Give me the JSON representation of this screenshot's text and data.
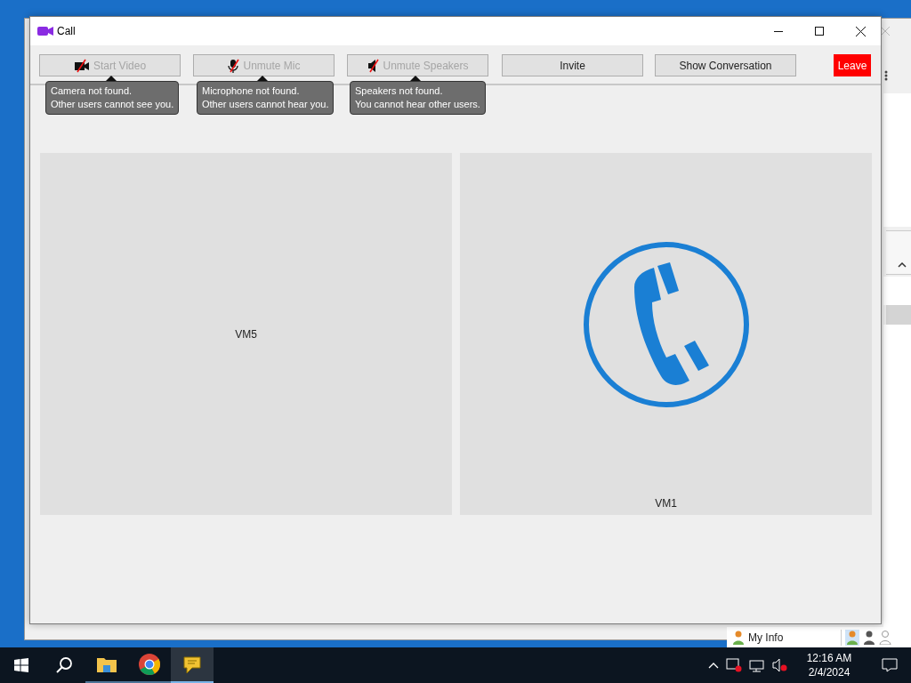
{
  "window": {
    "title": "Call"
  },
  "toolbar": {
    "buttons": [
      {
        "label": "Start Video",
        "kind": "video",
        "disabled": true,
        "tooltip": [
          "Camera not found.",
          "Other users cannot see you."
        ]
      },
      {
        "label": "Unmute Mic",
        "kind": "mic",
        "disabled": true,
        "tooltip": [
          "Microphone not found.",
          "Other users cannot hear you."
        ]
      },
      {
        "label": "Unmute Speakers",
        "kind": "speaker",
        "disabled": true,
        "tooltip": [
          "Speakers not found.",
          "You cannot hear other users."
        ]
      },
      {
        "label": "Invite",
        "kind": "plain",
        "disabled": false
      },
      {
        "label": "Show Conversation",
        "kind": "plain",
        "disabled": false
      },
      {
        "label": "Leave",
        "kind": "leave",
        "disabled": false
      }
    ]
  },
  "participants": [
    {
      "name": "VM5",
      "kind": "blank"
    },
    {
      "name": "VM1",
      "kind": "phone"
    }
  ],
  "background_window": {
    "status_bar": {
      "label": "My Info"
    }
  },
  "taskbar": {
    "apps": [
      {
        "kind": "folder",
        "selected": false
      },
      {
        "kind": "browser",
        "selected": false
      },
      {
        "kind": "chat",
        "selected": true
      }
    ],
    "clock": {
      "time": "12:16 AM",
      "date": "2/4/2024"
    }
  }
}
